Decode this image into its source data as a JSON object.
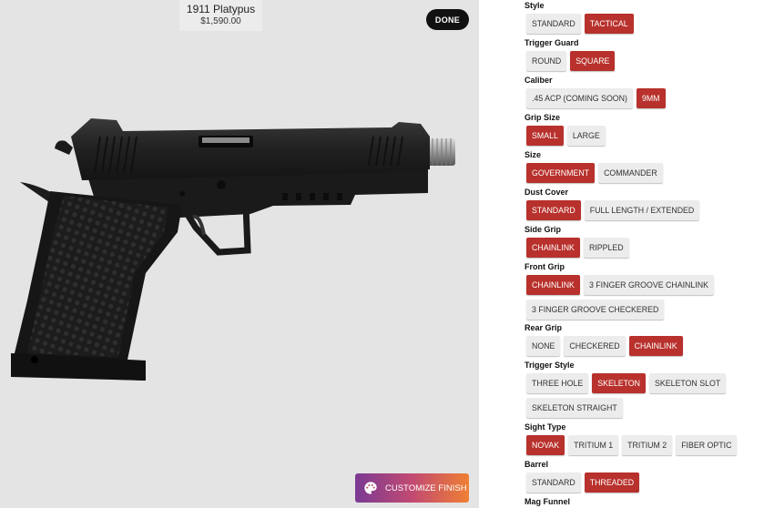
{
  "product": {
    "name": "1911 Platypus",
    "price": "$1,590.00"
  },
  "done_label": "DONE",
  "customize_label": "CUSTOMIZE FINISH",
  "colors": {
    "selected": "#b8312c",
    "unselected": "#ececec"
  },
  "options": [
    {
      "label": "Style",
      "items": [
        {
          "text": "STANDARD",
          "selected": false
        },
        {
          "text": "TACTICAL",
          "selected": true
        }
      ]
    },
    {
      "label": "Trigger Guard",
      "items": [
        {
          "text": "ROUND",
          "selected": false
        },
        {
          "text": "SQUARE",
          "selected": true
        }
      ]
    },
    {
      "label": "Caliber",
      "items": [
        {
          "text": ".45 ACP (COMING SOON)",
          "selected": false
        },
        {
          "text": "9MM",
          "selected": true
        }
      ]
    },
    {
      "label": "Grip Size",
      "items": [
        {
          "text": "SMALL",
          "selected": true
        },
        {
          "text": "LARGE",
          "selected": false
        }
      ]
    },
    {
      "label": "Size",
      "items": [
        {
          "text": "GOVERNMENT",
          "selected": true
        },
        {
          "text": "COMMANDER",
          "selected": false
        }
      ]
    },
    {
      "label": "Dust Cover",
      "items": [
        {
          "text": "STANDARD",
          "selected": true
        },
        {
          "text": "FULL LENGTH / EXTENDED",
          "selected": false
        }
      ]
    },
    {
      "label": "Side Grip",
      "items": [
        {
          "text": "CHAINLINK",
          "selected": true
        },
        {
          "text": "RIPPLED",
          "selected": false
        }
      ]
    },
    {
      "label": "Front Grip",
      "items": [
        {
          "text": "CHAINLINK",
          "selected": true
        },
        {
          "text": "3 FINGER GROOVE CHAINLINK",
          "selected": false
        }
      ],
      "items2": [
        {
          "text": "3 FINGER GROOVE CHECKERED",
          "selected": false
        }
      ]
    },
    {
      "label": "Rear Grip",
      "items": [
        {
          "text": "NONE",
          "selected": false
        },
        {
          "text": "CHECKERED",
          "selected": false
        },
        {
          "text": "CHAINLINK",
          "selected": true
        }
      ]
    },
    {
      "label": "Trigger Style",
      "items": [
        {
          "text": "THREE HOLE",
          "selected": false
        },
        {
          "text": "SKELETON",
          "selected": true
        },
        {
          "text": "SKELETON SLOT",
          "selected": false
        }
      ],
      "items2": [
        {
          "text": "SKELETON STRAIGHT",
          "selected": false
        }
      ]
    },
    {
      "label": "Sight Type",
      "items": [
        {
          "text": "NOVAK",
          "selected": true
        },
        {
          "text": "TRITIUM 1",
          "selected": false
        },
        {
          "text": "TRITIUM 2",
          "selected": false
        },
        {
          "text": "FIBER OPTIC",
          "selected": false
        }
      ]
    },
    {
      "label": "Barrel",
      "items": [
        {
          "text": "STANDARD",
          "selected": false
        },
        {
          "text": "THREADED",
          "selected": true
        }
      ]
    },
    {
      "label": "Mag Funnel",
      "items": []
    }
  ]
}
